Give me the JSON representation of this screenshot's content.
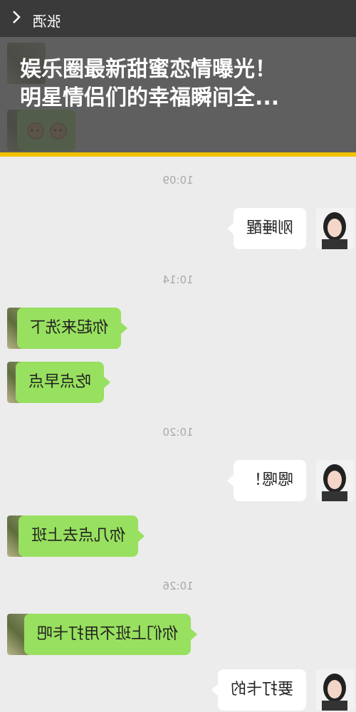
{
  "article": {
    "headline_line1": "娱乐圈最新甜蜜恋情曝光！",
    "headline_line2": "明星情侣们的幸福瞬间全..."
  },
  "chat": {
    "contact_name": "张洒",
    "messages": [
      {
        "time": "10:09",
        "side": "right",
        "text": "刚睡醒"
      },
      {
        "time": "10:14",
        "side": "left",
        "text": "你起来洗下"
      },
      {
        "side": "left",
        "text": "吃点早点"
      },
      {
        "time": "10:20",
        "side": "right",
        "text": "嗯嗯！"
      },
      {
        "side": "left",
        "text": "你几点去上班"
      },
      {
        "time": "10:26",
        "side": "left",
        "text": "你们上班不用打卡吧"
      },
      {
        "side": "right",
        "text": "要打卡的"
      }
    ]
  },
  "colors": {
    "accent_bar": "#f2c200",
    "sent_bubble": "#98e05f",
    "received_bubble": "#ffffff"
  }
}
